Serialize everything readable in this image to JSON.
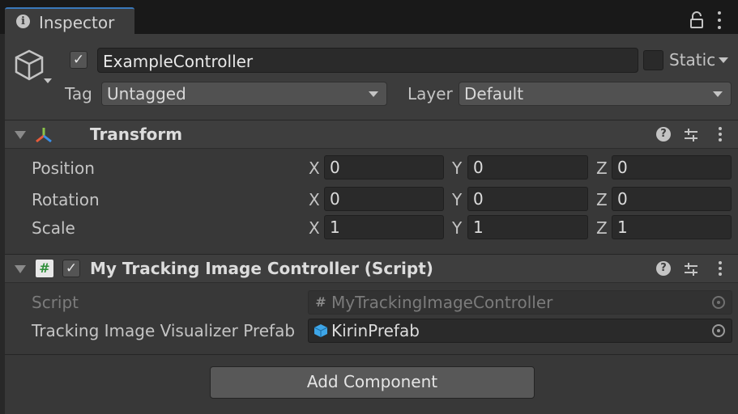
{
  "window": {
    "tab_label": "Inspector"
  },
  "object": {
    "name": "ExampleController",
    "active_checked": true,
    "static_label": "Static",
    "static_checked": false,
    "tag_label": "Tag",
    "tag_value": "Untagged",
    "layer_label": "Layer",
    "layer_value": "Default"
  },
  "transform": {
    "title": "Transform",
    "rows": [
      {
        "label": "Position",
        "x": "0",
        "y": "0",
        "z": "0"
      },
      {
        "label": "Rotation",
        "x": "0",
        "y": "0",
        "z": "0"
      },
      {
        "label": "Scale",
        "x": "1",
        "y": "1",
        "z": "1"
      }
    ],
    "axis": {
      "x": "X",
      "y": "Y",
      "z": "Z"
    }
  },
  "script_component": {
    "title": "My Tracking Image Controller (Script)",
    "enabled_checked": true,
    "script_label": "Script",
    "script_value": "MyTrackingImageController",
    "prefab_label": "Tracking Image Visualizer Prefab",
    "prefab_value": "KirinPrefab"
  },
  "footer": {
    "add_component_label": "Add Component"
  },
  "icons": {
    "tab": "info-icon",
    "lock": "lock-icon",
    "menu": "kebab-menu-icon",
    "gameobject": "cube-icon",
    "transform": "transform-axes-icon",
    "script": "csharp-script-icon",
    "help": "help-icon",
    "presets": "presets-icon",
    "target": "object-picker-icon",
    "prefab": "prefab-cube-icon"
  },
  "colors": {
    "tab_accent": "#3a79bb",
    "script_icon": "#2f8f3a",
    "prefab_icon": "#3ea6e8"
  }
}
